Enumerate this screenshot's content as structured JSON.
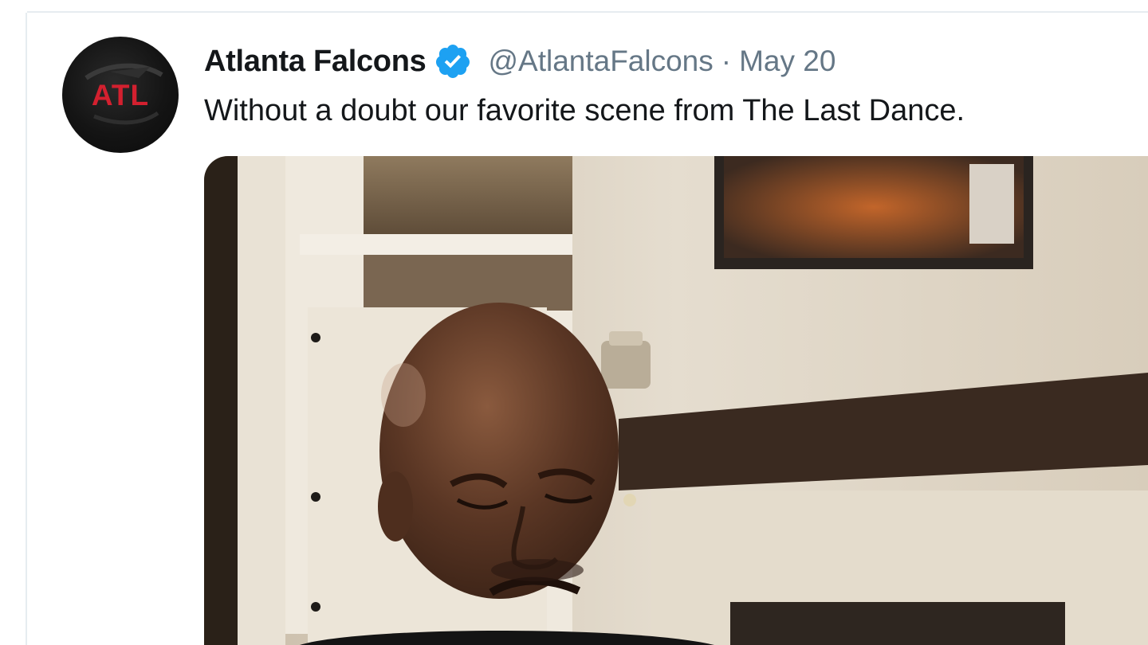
{
  "tweet": {
    "display_name": "Atlanta Falcons",
    "verified": true,
    "handle": "@AtlantaFalcons",
    "separator": "·",
    "timestamp": "May 20",
    "text": "Without a doubt our favorite scene from The Last Dance.",
    "avatar": {
      "logo_text": "ATL",
      "logo_color": "#d3202f"
    },
    "media_type": "video-still"
  },
  "colors": {
    "text_primary": "#14171a",
    "text_secondary": "#657786",
    "verified_blue": "#1da1f2",
    "border": "#e6ecf0"
  }
}
